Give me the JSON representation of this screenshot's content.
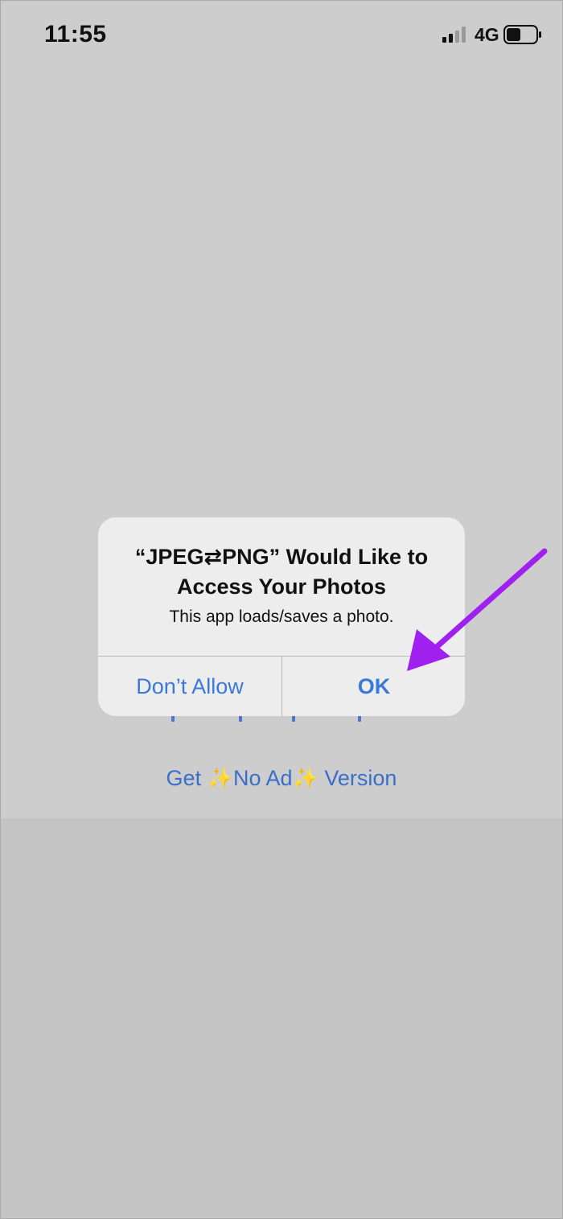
{
  "status_bar": {
    "time": "11:55",
    "network": "4G",
    "signal_icon": "cellular-signal-icon",
    "battery_icon": "battery-icon"
  },
  "alert": {
    "title": "“JPEG⇄PNG” Would Like to Access Your Photos",
    "message": "This app loads/saves a photo.",
    "deny_label": "Don’t Allow",
    "ok_label": "OK"
  },
  "upgrade_link": {
    "prefix": "Get ",
    "sparkle": "✨",
    "middle": "No Ad",
    "suffix": " Version"
  },
  "annotation": {
    "arrow_color": "#a020f0"
  },
  "colors": {
    "accent": "#3a78dc",
    "link": "#3a6fc9",
    "arrow": "#a020f0"
  }
}
